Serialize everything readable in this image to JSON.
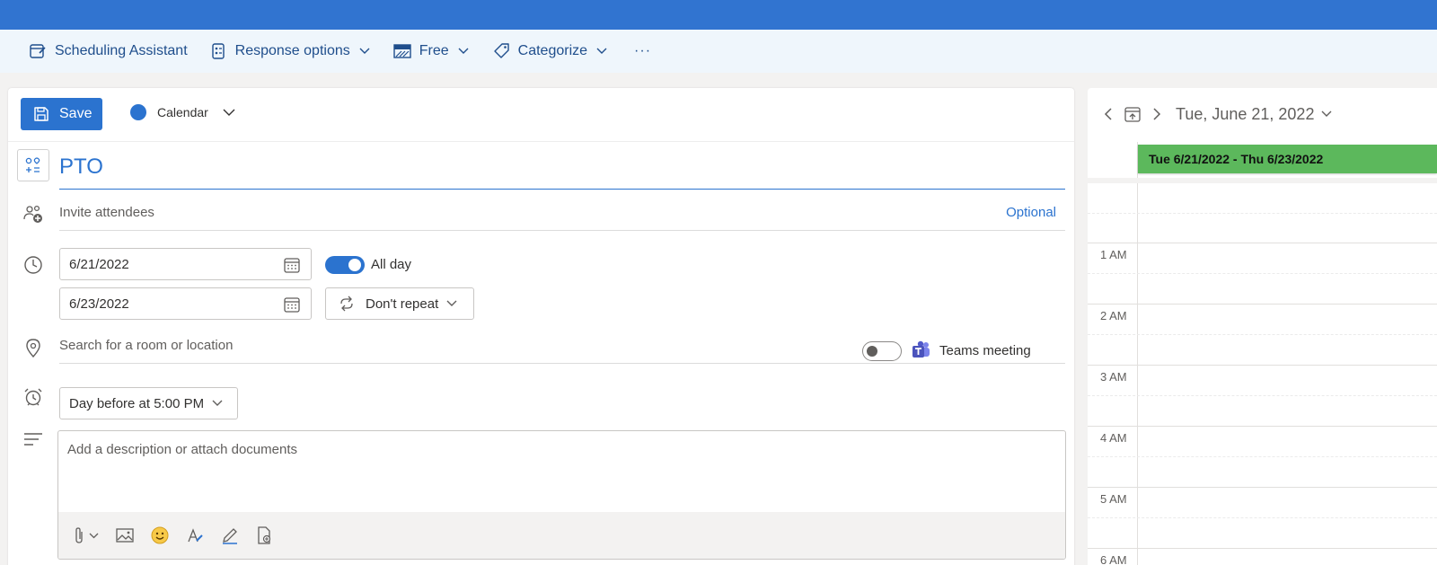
{
  "ribbon": {
    "scheduling_assistant": "Scheduling Assistant",
    "response_options": "Response options",
    "show_as": "Free",
    "categorize": "Categorize",
    "more": "···"
  },
  "form": {
    "save_label": "Save",
    "calendar_name": "Calendar",
    "calendar_color": "#2b73cf",
    "title": "PTO",
    "attendees_placeholder": "Invite attendees",
    "optional_label": "Optional",
    "start_date": "6/21/2022",
    "end_date": "6/23/2022",
    "all_day_label": "All day",
    "all_day_on": true,
    "repeat_label": "Don't repeat",
    "location_placeholder": "Search for a room or location",
    "teams_label": "Teams meeting",
    "teams_on": false,
    "reminder": "Day before at 5:00 PM",
    "description_placeholder": "Add a description or attach documents"
  },
  "calendar_pane": {
    "date_label": "Tue, June 21, 2022",
    "all_day_event": "Tue 6/21/2022 - Thu 6/23/2022",
    "event_color": "#5cb85c",
    "hours": [
      "1 AM",
      "2 AM",
      "3 AM",
      "4 AM",
      "5 AM",
      "6 AM"
    ]
  },
  "colors": {
    "accent": "#2b73cf",
    "top_bar": "#3174d0",
    "ribbon_bg": "#eff6fc"
  }
}
